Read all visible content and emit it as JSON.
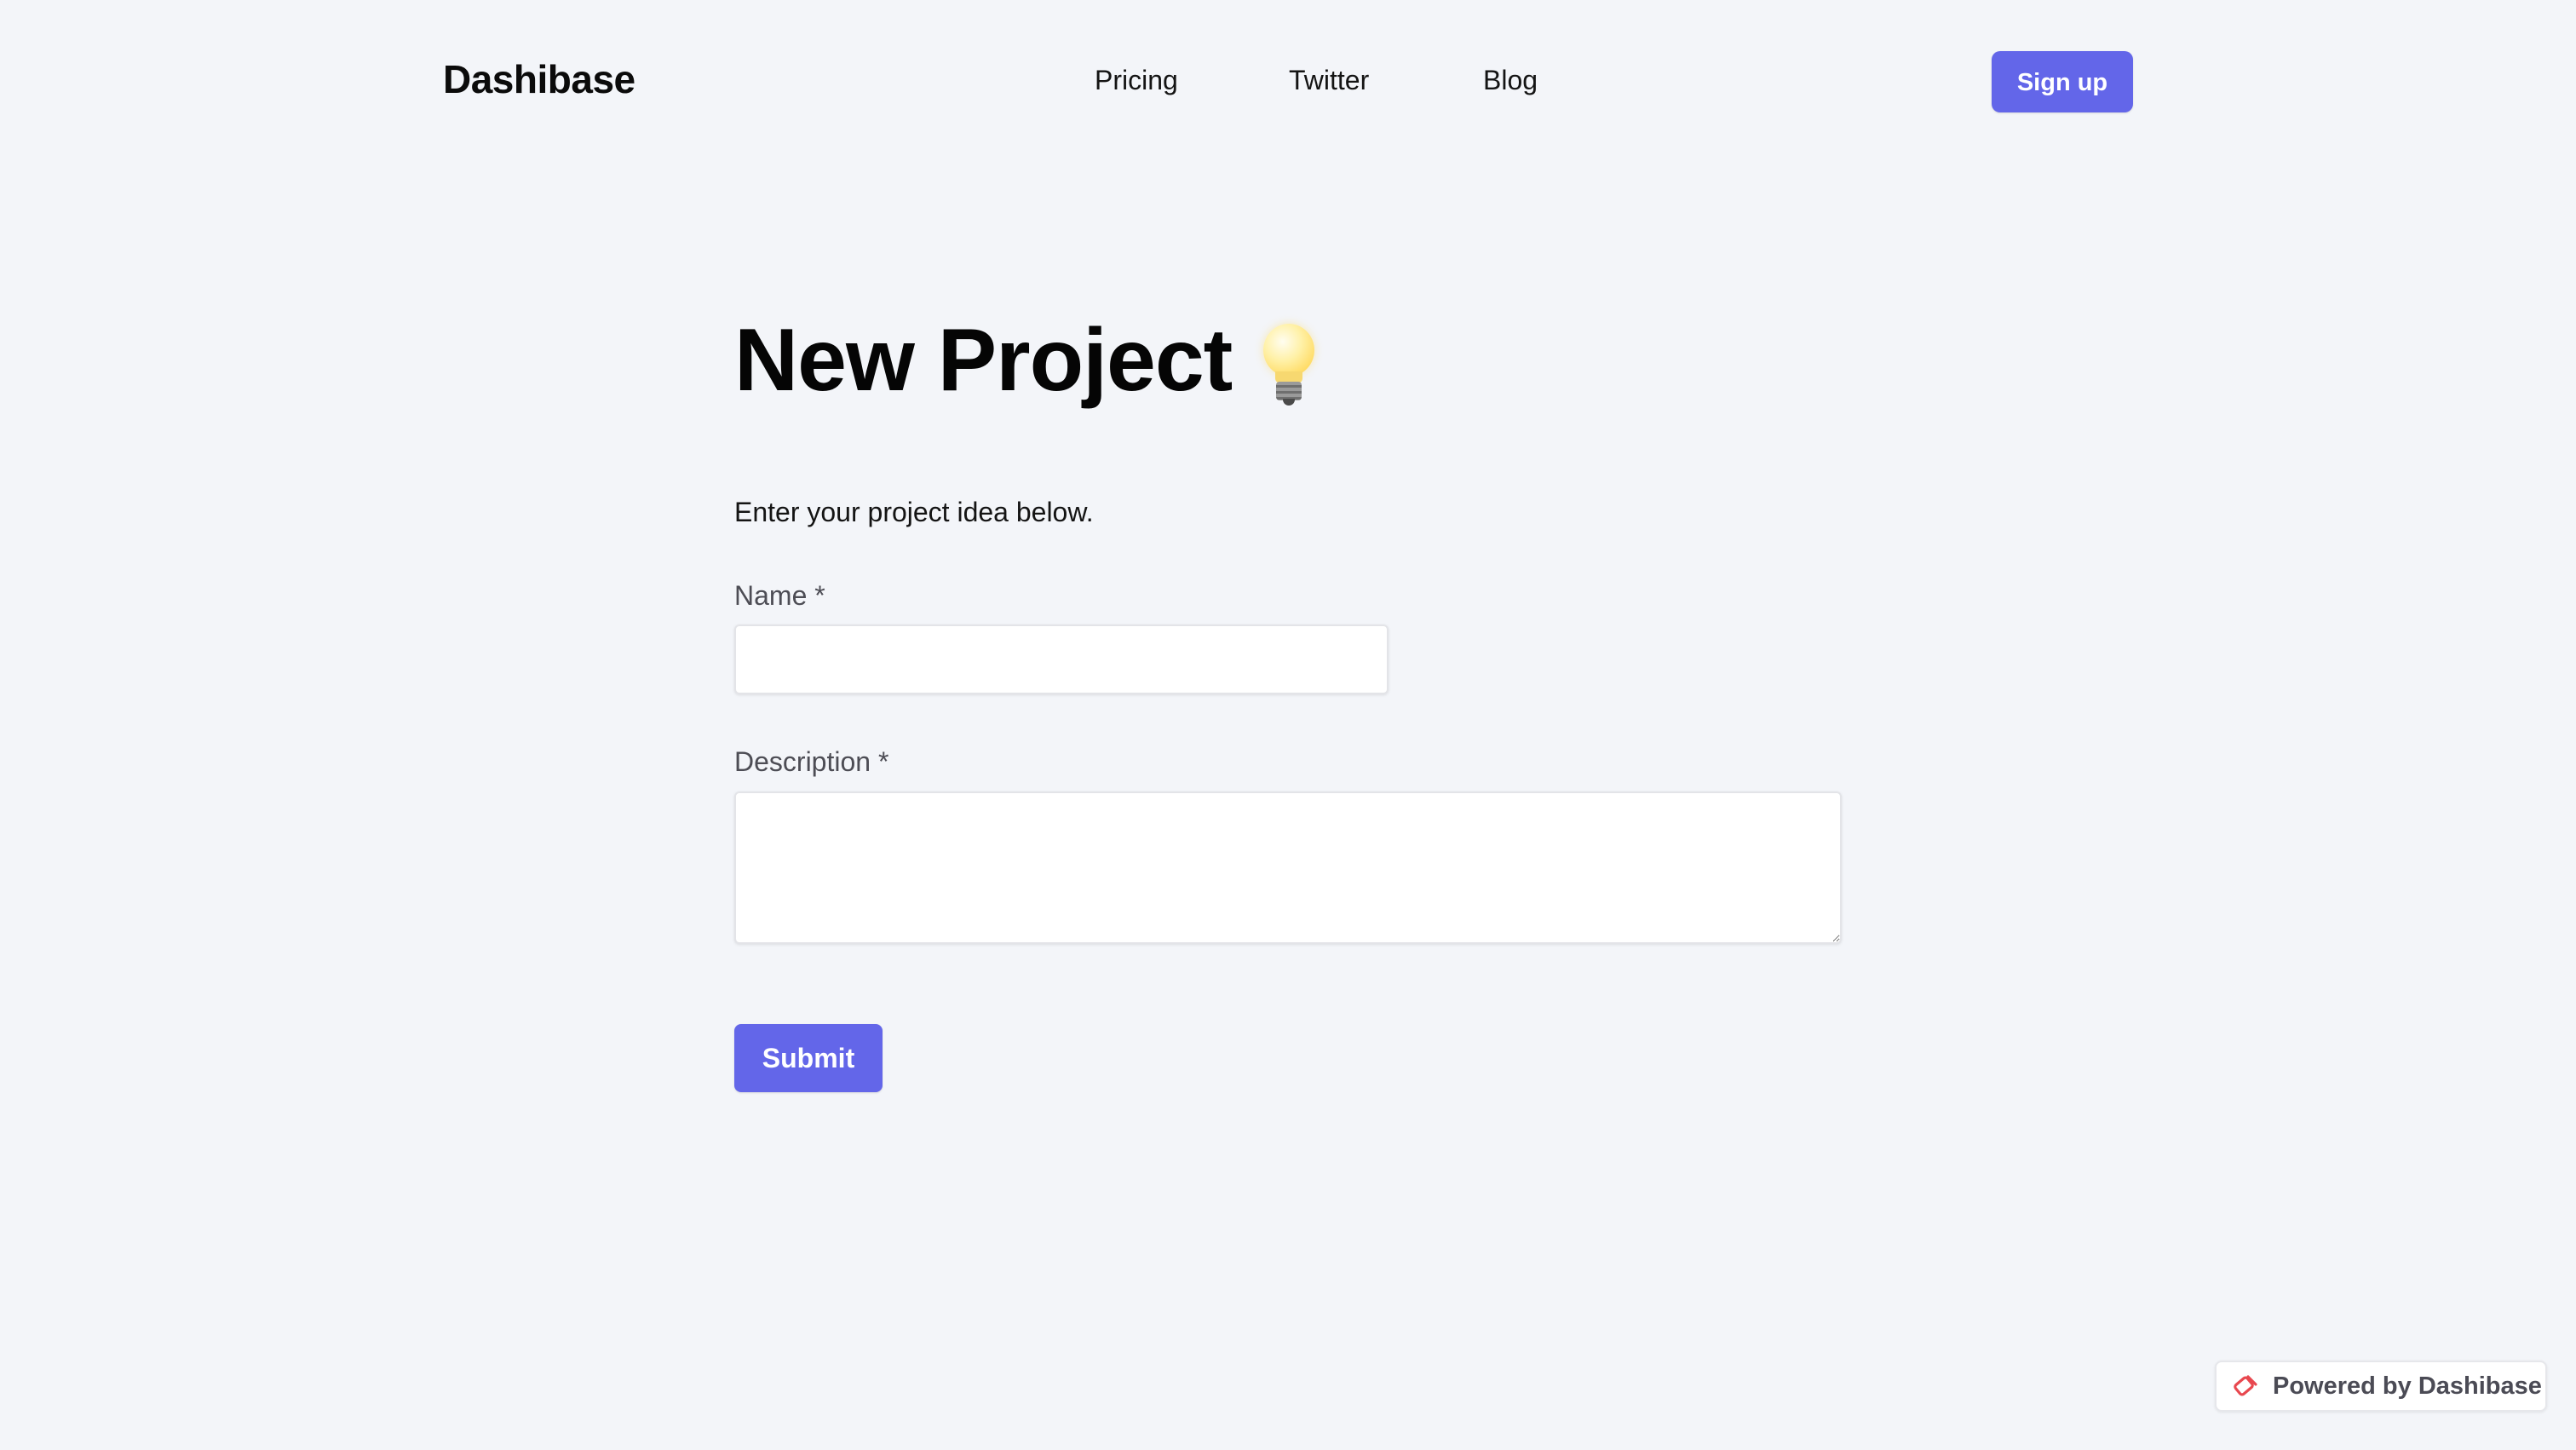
{
  "header": {
    "logo": "Dashibase",
    "nav": [
      {
        "label": "Pricing"
      },
      {
        "label": "Twitter"
      },
      {
        "label": "Blog"
      }
    ],
    "signup_label": "Sign up"
  },
  "main": {
    "title": "New Project",
    "title_icon": "lightbulb-icon",
    "subtitle": "Enter your project idea below.",
    "fields": {
      "name": {
        "label": "Name *",
        "value": "",
        "placeholder": ""
      },
      "description": {
        "label": "Description *",
        "value": "",
        "placeholder": ""
      }
    },
    "submit_label": "Submit"
  },
  "footer": {
    "powered_label": "Powered by Dashibase",
    "powered_icon": "dashibase-logo-icon"
  },
  "colors": {
    "accent": "#6366e9",
    "background": "#f3f5f9",
    "label": "#4d4d55",
    "badge_icon": "#e8484f"
  }
}
